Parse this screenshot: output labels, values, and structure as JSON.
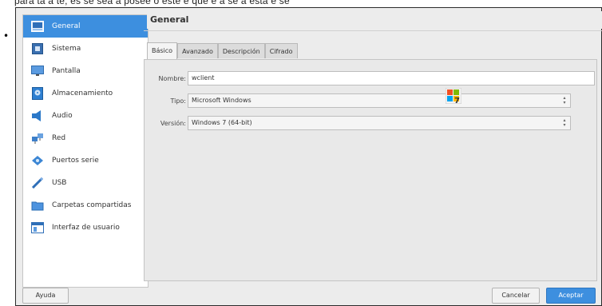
{
  "top_text": "para ta a te, es se sea a posee o este e que e a se a esta e se",
  "sidebar": {
    "items": [
      {
        "label": "General",
        "icon": "general-icon",
        "selected": true
      },
      {
        "label": "Sistema",
        "icon": "system-icon"
      },
      {
        "label": "Pantalla",
        "icon": "display-icon"
      },
      {
        "label": "Almacenamiento",
        "icon": "storage-icon"
      },
      {
        "label": "Audio",
        "icon": "audio-icon"
      },
      {
        "label": "Red",
        "icon": "network-icon"
      },
      {
        "label": "Puertos serie",
        "icon": "serial-ports-icon"
      },
      {
        "label": "USB",
        "icon": "usb-icon"
      },
      {
        "label": "Carpetas compartidas",
        "icon": "shared-folders-icon"
      },
      {
        "label": "Interfaz de usuario",
        "icon": "user-interface-icon"
      }
    ]
  },
  "main": {
    "title": "General",
    "tabs": [
      "Básico",
      "Avanzado",
      "Descripción",
      "Cifrado"
    ],
    "active_tab": "Básico",
    "form": {
      "name_label": "Nombre:",
      "name_value": "wclient",
      "type_label": "Tipo:",
      "type_value": "Microsoft Windows",
      "version_label": "Versión:",
      "version_value": "Windows 7 (64-bit)"
    }
  },
  "footer": {
    "help_label": "Ayuda",
    "cancel_label": "Cancelar",
    "accept_label": "Aceptar"
  },
  "colors": {
    "selection": "#3d8fdf",
    "dialog_bg": "#ececec"
  }
}
